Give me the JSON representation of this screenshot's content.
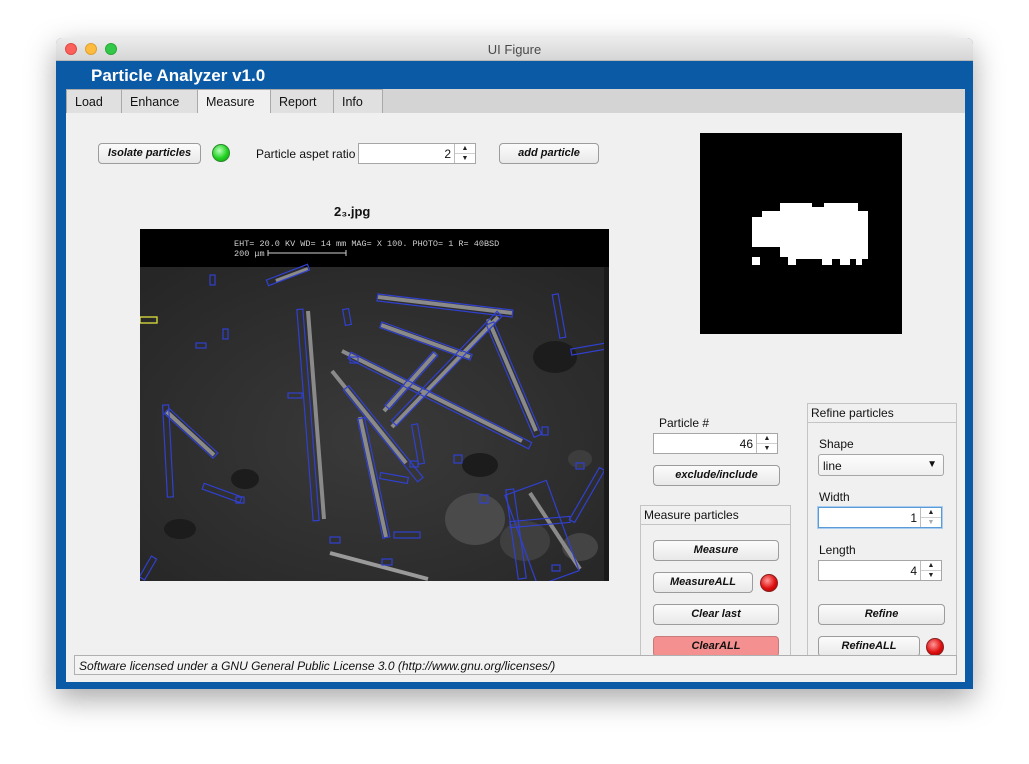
{
  "window": {
    "title": "UI Figure"
  },
  "app": {
    "title": "Particle Analyzer  v1.0"
  },
  "tabs": [
    {
      "label": "Load"
    },
    {
      "label": "Enhance"
    },
    {
      "label": "Measure"
    },
    {
      "label": "Report"
    },
    {
      "label": "Info"
    }
  ],
  "active_tab": "Measure",
  "toolbar": {
    "isolate_label": "Isolate particles",
    "aspect_label": "Particle aspet ratio",
    "aspect_value": "2",
    "add_label": "add particle"
  },
  "image": {
    "title": "2₃.jpg",
    "overlay_text": "EHT= 20.0 KV   WD= 14  mm    MAG= X 100.   PHOTO= 1      R= 40BSD",
    "scale_text": "200 μm"
  },
  "particle": {
    "label": "Particle #",
    "value": "46",
    "exclude_label": "exclude/include"
  },
  "measure": {
    "group_title": "Measure particles",
    "measure_label": "Measure",
    "measure_all_label": "MeasureALL",
    "clear_last_label": "Clear last",
    "clear_all_label": "ClearALL"
  },
  "refine": {
    "group_title": "Refine particles",
    "shape_label": "Shape",
    "shape_value": "line",
    "width_label": "Width",
    "width_value": "1",
    "length_label": "Length",
    "length_value": "4",
    "refine_label": "Refine",
    "refine_all_label": "RefineALL"
  },
  "status": {
    "text": "Software licensed under a GNU General Public License 3.0 (http://www.gnu.org/licenses/)"
  },
  "colors": {
    "accent": "#0a5aa6",
    "overlay": "#3040d0",
    "led_green": "#21d121",
    "led_red": "#e01010",
    "clear_all": "#f4908f"
  }
}
